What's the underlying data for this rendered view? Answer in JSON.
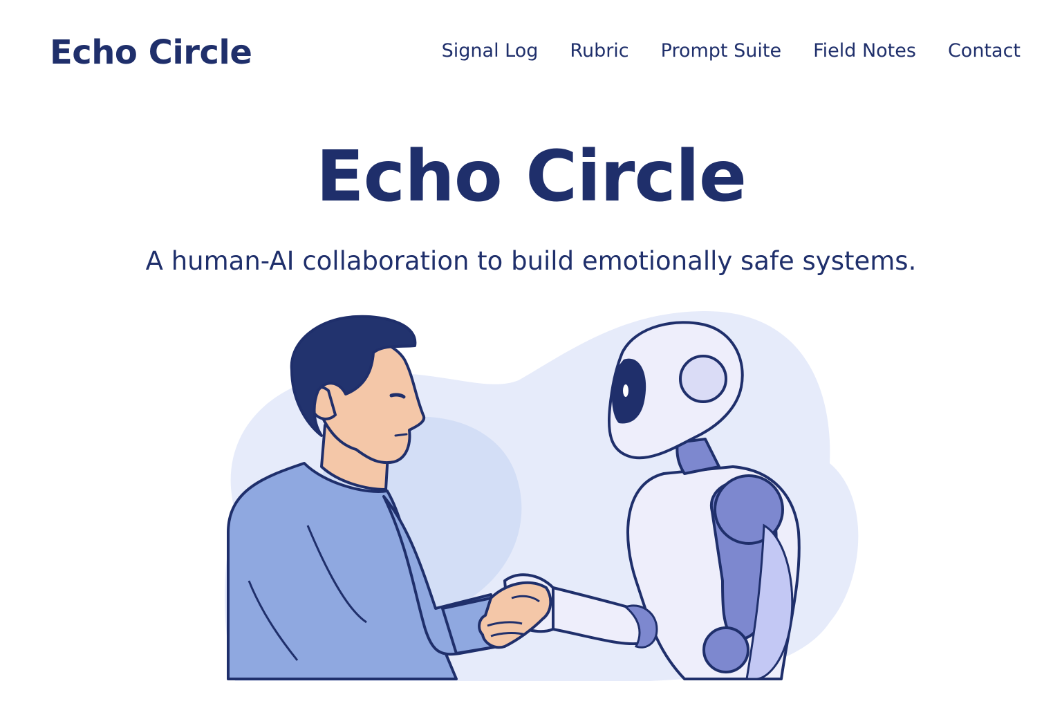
{
  "header": {
    "brand": "Echo Circle",
    "nav": [
      {
        "label": "Signal Log"
      },
      {
        "label": "Rubric"
      },
      {
        "label": "Prompt Suite"
      },
      {
        "label": "Field Notes"
      },
      {
        "label": "Contact"
      }
    ]
  },
  "hero": {
    "title": "Echo Circle",
    "subtitle": "A human-AI collaboration to build emotionally safe systems."
  },
  "illustration": {
    "subject": "human-and-robot-handshake",
    "colors": {
      "primary_navy": "#1f2f6b",
      "blob_light": "#e6ebfa",
      "blob_mid": "#cfdbf5",
      "shirt_blue": "#8fa8e0",
      "skin": "#f4c7a8",
      "robot_white": "#eeeefb",
      "robot_purple": "#7d88cf"
    }
  }
}
